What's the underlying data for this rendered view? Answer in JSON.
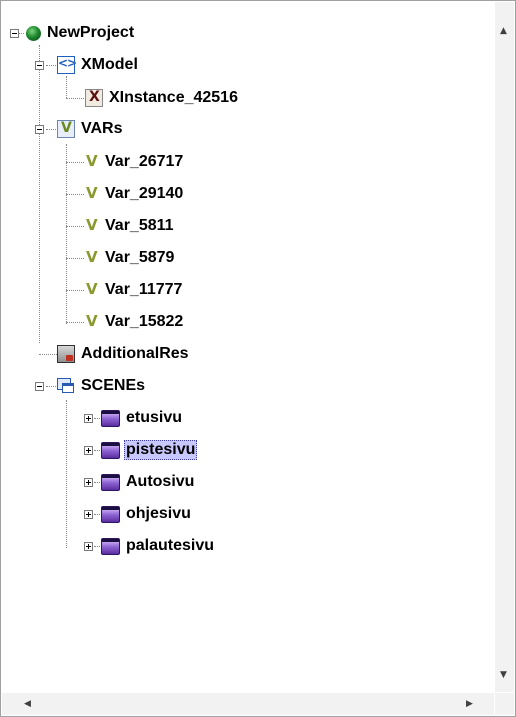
{
  "tree": {
    "root": {
      "label": "NewProject",
      "icon": "globe-icon"
    },
    "xmodel": {
      "label": "XModel",
      "icon": "xmodel-icon",
      "children": [
        {
          "label": "XInstance_42516",
          "icon": "xinstance-icon"
        }
      ]
    },
    "vars": {
      "label": "VARs",
      "icon": "vars-folder-icon",
      "children": [
        {
          "label": "Var_26717",
          "icon": "variable-icon"
        },
        {
          "label": "Var_29140",
          "icon": "variable-icon"
        },
        {
          "label": "Var_5811",
          "icon": "variable-icon"
        },
        {
          "label": "Var_5879",
          "icon": "variable-icon"
        },
        {
          "label": "Var_11777",
          "icon": "variable-icon"
        },
        {
          "label": "Var_15822",
          "icon": "variable-icon"
        }
      ]
    },
    "additional": {
      "label": "AdditionalRes",
      "icon": "resources-icon"
    },
    "scenes": {
      "label": "SCENEs",
      "icon": "scenes-folder-icon",
      "children": [
        {
          "label": "etusivu",
          "icon": "scene-icon",
          "selected": false
        },
        {
          "label": "pistesivu",
          "icon": "scene-icon",
          "selected": true
        },
        {
          "label": "Autosivu",
          "icon": "scene-icon",
          "selected": false
        },
        {
          "label": "ohjesivu",
          "icon": "scene-icon",
          "selected": false
        },
        {
          "label": "palautesivu",
          "icon": "scene-icon",
          "selected": false
        }
      ]
    }
  },
  "scrollbars": {
    "vertical": {
      "up_arrow": "▲",
      "down_arrow": "▼"
    },
    "horizontal": {
      "left_arrow": "◀",
      "right_arrow": "▶"
    }
  },
  "colors": {
    "selection": "#c8c8ff",
    "connector": "#8a8a8a"
  }
}
